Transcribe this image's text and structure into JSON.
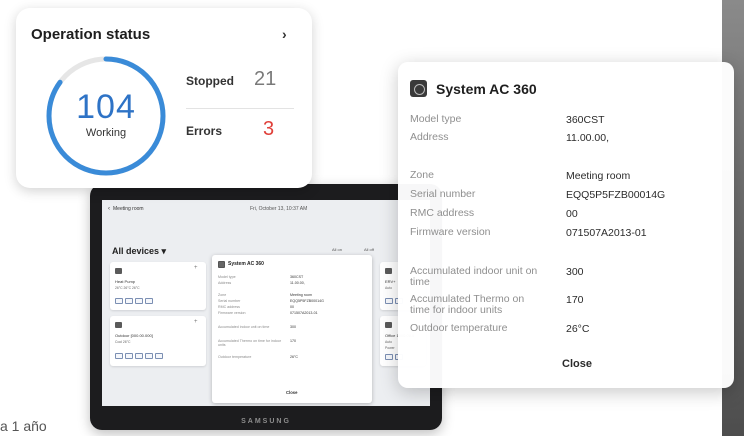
{
  "caption": "a 1 año",
  "operation_status": {
    "title": "Operation status",
    "chevron_icon": "chevron-right-icon",
    "working_count": "104",
    "working_label": "Working",
    "working_fraction": 0.85,
    "ring_color": "#3a8bd8",
    "stopped_label": "Stopped",
    "stopped_value": "21",
    "stopped_color": "#7a7a7a",
    "errors_label": "Errors",
    "errors_value": "3",
    "errors_color": "#e0403a"
  },
  "tablet": {
    "brand": "SAMSUNG",
    "back_label": "Meeting room",
    "datetime": "Fri, October 13, 10:37 AM",
    "devices_title": "All devices",
    "sort_label": "All on",
    "filter_label": "All off",
    "cards": [
      {
        "name": "Heat Pump",
        "rows": [
          "26°C  26°C  26°C"
        ]
      },
      {
        "name": "Outdoor [000.00.000]",
        "rows": [
          "Cool  26°C"
        ]
      },
      {
        "name": "ERV+",
        "rows": [
          "Auto"
        ]
      },
      {
        "name": "Office 1000.00.0",
        "rows": [
          "Auto",
          "Power"
        ]
      }
    ],
    "popup": {
      "title": "System AC 360",
      "rows": [
        {
          "label": "Model type",
          "value": "360CST"
        },
        {
          "label": "Address",
          "value": "11.00.00,"
        },
        {
          "label": "Zone",
          "value": "Meeting room"
        },
        {
          "label": "Serial number",
          "value": "EQQ5P5FZB00014G"
        },
        {
          "label": "RMC address",
          "value": "00"
        },
        {
          "label": "Firmware version",
          "value": "071507A2013-01"
        },
        {
          "label": "Accumulated indoor unit on time",
          "value": "300"
        },
        {
          "label": "Accumulated Thermo on time for indoor units",
          "value": "170"
        },
        {
          "label": "Outdoor temperature",
          "value": "26°C"
        }
      ],
      "close": "Close"
    }
  },
  "dialog": {
    "icon": "ac-unit-icon",
    "title": "System AC 360",
    "model_type_label": "Model type",
    "model_type_value": "360CST",
    "address_label": "Address",
    "address_value": "11.00.00,",
    "zone_label": "Zone",
    "zone_value": "Meeting room",
    "serial_label": "Serial number",
    "serial_value": "EQQ5P5FZB00014G",
    "rmc_label": "RMC address",
    "rmc_value": "00",
    "firmware_label": "Firmware version",
    "firmware_value": "071507A2013-01",
    "indoor_on_label": "Accumulated indoor unit on time",
    "indoor_on_value": "300",
    "thermo_label": "Accumulated Thermo on time for indoor units",
    "thermo_value": "170",
    "outdoor_temp_label": "Outdoor temperature",
    "outdoor_temp_value": "26°C",
    "close_label": "Close"
  }
}
